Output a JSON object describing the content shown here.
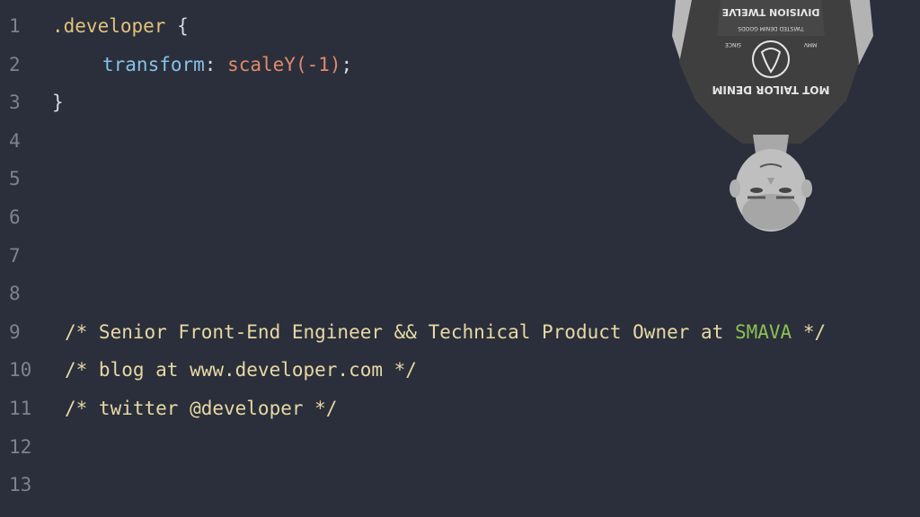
{
  "editor": {
    "line_numbers": [
      "1",
      "2",
      "3",
      "4",
      "5",
      "6",
      "7",
      "8",
      "9",
      "10",
      "11",
      "12",
      "13"
    ],
    "code": {
      "selector": ".developer",
      "open_brace": " {",
      "property": "transform",
      "colon": ": ",
      "value": "scaleY(-1)",
      "semicolon": ";",
      "close_brace": "}",
      "comment_role_prefix": "/* Senior Front-End Engineer && Technical Product Owner at ",
      "comment_role_company": "SMAVA",
      "comment_role_suffix": " */",
      "comment_blog": "/* blog at www.developer.com */",
      "comment_twitter": "/* twitter @developer */"
    }
  },
  "photo": {
    "description_icon": "upside-down-person-photo",
    "shirt_text_main": "DIVISION TWELVE",
    "shirt_text_arc": "MOT TAILOR DENIM",
    "shirt_text_small": "TWISTED DENIM GOODS",
    "shirt_since": "SINCE",
    "shirt_mmv": "MMV"
  },
  "colors": {
    "background": "#2a2f3b",
    "line_number": "#7d8390",
    "selector": "#e3c17b",
    "property": "#86c2e8",
    "function": "#e38a6a",
    "comment": "#e8d8a3",
    "accent": "#8cc152"
  }
}
